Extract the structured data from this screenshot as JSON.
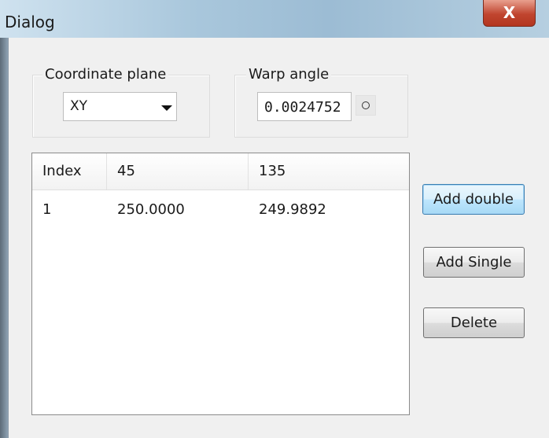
{
  "window": {
    "title": "Dialog",
    "close_glyph": "X"
  },
  "coordinate_plane": {
    "label": "Coordinate plane",
    "selected": "XY"
  },
  "warp_angle": {
    "label": "Warp angle",
    "value": "0.0024752"
  },
  "table": {
    "columns": [
      "Index",
      "45",
      "135"
    ],
    "rows": [
      [
        "1",
        "250.0000",
        "249.9892"
      ]
    ]
  },
  "buttons": {
    "add_double": "Add double",
    "add_single": "Add Single",
    "delete": "Delete"
  },
  "icons": {
    "close": "close-icon",
    "combo_arrow": "chevron-down-icon",
    "angle_picker": "circle-icon"
  }
}
